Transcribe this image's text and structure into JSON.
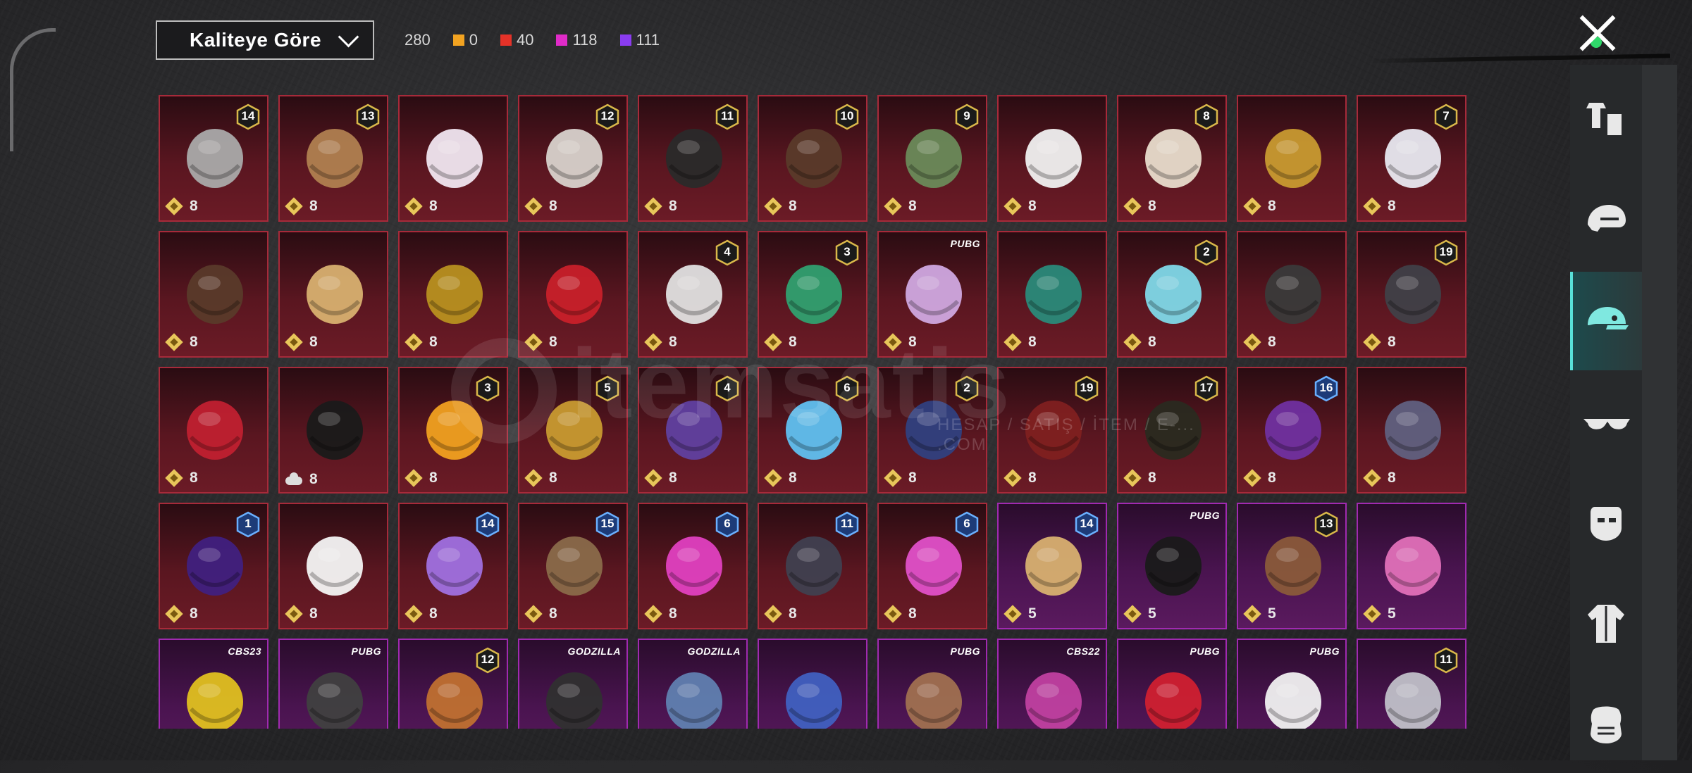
{
  "sort": {
    "label": "Kaliteye Göre"
  },
  "counts": {
    "total": "280",
    "tiers": [
      {
        "color": "#f2a321",
        "value": "0"
      },
      {
        "color": "#e53228",
        "value": "40"
      },
      {
        "color": "#e02bc8",
        "value": "118"
      },
      {
        "color": "#8a3cf0",
        "value": "111"
      }
    ]
  },
  "sidebar": {
    "items": [
      {
        "icon": "outfit-icon",
        "active": false
      },
      {
        "icon": "helmet-icon",
        "active": false
      },
      {
        "icon": "cap-icon",
        "active": true
      },
      {
        "icon": "glasses-icon",
        "active": false
      },
      {
        "icon": "mask-icon",
        "active": false
      },
      {
        "icon": "jacket-icon",
        "active": false
      },
      {
        "icon": "face-mask-icon",
        "active": false
      }
    ]
  },
  "watermark": {
    "brand": "itemsatis",
    "sub": "HESAP / SATIŞ / İTEM / E-... .COM"
  },
  "items": [
    {
      "q": "red",
      "badge": "14",
      "val": "8",
      "icon": "cat-ear-mask-hair-icon",
      "c": "#aaa"
    },
    {
      "q": "red",
      "badge": "13",
      "val": "8",
      "icon": "pink-hat-hair-icon",
      "c": "#b08050"
    },
    {
      "q": "red",
      "badge": "",
      "val": "8",
      "icon": "white-ponytail-icon",
      "c": "#f0e6f0"
    },
    {
      "q": "red",
      "badge": "12",
      "val": "8",
      "icon": "silver-bun-hair-icon",
      "c": "#d8d2cc"
    },
    {
      "q": "red",
      "badge": "11",
      "val": "8",
      "icon": "black-hair-icon",
      "c": "#2a2a2a"
    },
    {
      "q": "red",
      "badge": "10",
      "val": "8",
      "icon": "brown-long-hair-icon",
      "c": "#5a3a2a"
    },
    {
      "q": "red",
      "badge": "9",
      "val": "8",
      "icon": "zombie-head-icon",
      "c": "#6a8a5a"
    },
    {
      "q": "red",
      "badge": "",
      "val": "8",
      "icon": "white-cowboy-hat-icon",
      "c": "#f0f0f0"
    },
    {
      "q": "red",
      "badge": "8",
      "val": "8",
      "icon": "blonde-short-hair-icon",
      "c": "#e8dccc"
    },
    {
      "q": "red",
      "badge": "",
      "val": "8",
      "icon": "golden-laurel-head-icon",
      "c": "#c89a30"
    },
    {
      "q": "red",
      "badge": "7",
      "val": "8",
      "icon": "white-long-hair-icon",
      "c": "#e8e8f0"
    },
    {
      "q": "red",
      "badge": "",
      "val": "8",
      "icon": "cat-ear-curly-hair-icon",
      "c": "#5a3a2a"
    },
    {
      "q": "red",
      "badge": "",
      "val": "8",
      "icon": "blonde-ponytail-icon",
      "c": "#d8b070"
    },
    {
      "q": "red",
      "badge": "",
      "val": "8",
      "icon": "gold-robot-helmet-icon",
      "c": "#b89020"
    },
    {
      "q": "red",
      "badge": "",
      "val": "8",
      "icon": "red-helmet-icon",
      "c": "#c8202a"
    },
    {
      "q": "red",
      "badge": "4",
      "val": "8",
      "icon": "snowman-top-hat-icon",
      "c": "#e0e0e0"
    },
    {
      "q": "red",
      "badge": "3",
      "val": "8",
      "icon": "joker-head-icon",
      "c": "#30a070"
    },
    {
      "q": "red",
      "badge": "PUBG",
      "val": "8",
      "icon": "lavender-bob-hair-icon",
      "c": "#d0a8e0"
    },
    {
      "q": "red",
      "badge": "",
      "val": "8",
      "icon": "dragon-helmet-icon",
      "c": "#2a8a7a"
    },
    {
      "q": "red",
      "badge": "2",
      "val": "8",
      "icon": "blue-bucket-hat-icon",
      "c": "#80d8e8"
    },
    {
      "q": "red",
      "badge": "",
      "val": "8",
      "icon": "oni-mask-helmet-icon",
      "c": "#3a3a3a"
    },
    {
      "q": "red",
      "badge": "19",
      "val": "8",
      "icon": "dark-armor-helmet-icon",
      "c": "#404048"
    },
    {
      "q": "red",
      "badge": "",
      "val": "8",
      "icon": "red-cyber-helmet-icon",
      "c": "#c02030"
    },
    {
      "q": "red",
      "badge": "",
      "val": "8",
      "icon": "black-bat-helmet-icon",
      "c": "#1a1a1a",
      "cloud": true
    },
    {
      "q": "red",
      "badge": "3",
      "val": "8",
      "icon": "fries-hat-icon",
      "c": "#f0a020"
    },
    {
      "q": "red",
      "badge": "5",
      "val": "8",
      "icon": "gold-knight-helmet-icon",
      "c": "#c89a30"
    },
    {
      "q": "red",
      "badge": "4",
      "val": "8",
      "icon": "purple-gold-helmet-icon",
      "c": "#6040a0"
    },
    {
      "q": "red",
      "badge": "6",
      "val": "8",
      "icon": "ice-block-head-icon",
      "c": "#60c0f0"
    },
    {
      "q": "red",
      "badge": "2",
      "val": "8",
      "icon": "samurai-mech-helmet-icon",
      "c": "#304080"
    },
    {
      "q": "red",
      "badge": "19",
      "val": "8",
      "icon": "demon-helmet-icon",
      "c": "#802020"
    },
    {
      "q": "red",
      "badge": "17",
      "val": "8",
      "icon": "black-gold-helmet-icon",
      "c": "#2a2a20"
    },
    {
      "q": "red",
      "badge": "16",
      "val": "8",
      "icon": "purple-neon-helmet-icon",
      "c": "#7030a0"
    },
    {
      "q": "red",
      "badge": "",
      "val": "8",
      "icon": "steel-visor-helmet-icon",
      "c": "#606080"
    },
    {
      "q": "red",
      "badge": "1",
      "val": "8",
      "icon": "purple-cyber-helmet-icon",
      "c": "#402080"
    },
    {
      "q": "red",
      "badge": "",
      "val": "8",
      "icon": "ghost-sheet-icon",
      "c": "#f4f4f4"
    },
    {
      "q": "red",
      "badge": "14",
      "val": "8",
      "icon": "lilac-fluffy-hair-icon",
      "c": "#a070e0"
    },
    {
      "q": "red",
      "badge": "15",
      "val": "8",
      "icon": "helmet-ponytail-icon",
      "c": "#8a6a4a"
    },
    {
      "q": "red",
      "badge": "6",
      "val": "8",
      "icon": "pink-tv-head-icon",
      "c": "#e040c0"
    },
    {
      "q": "red",
      "badge": "11",
      "val": "8",
      "icon": "visor-robot-helmet-icon",
      "c": "#404050"
    },
    {
      "q": "red",
      "badge": "6",
      "val": "8",
      "icon": "pink-monitor-head-icon",
      "c": "#e050c8"
    },
    {
      "q": "purple",
      "badge": "14",
      "val": "5",
      "icon": "blonde-flower-hair-icon",
      "c": "#d8b070"
    },
    {
      "q": "purple",
      "badge": "PUBG",
      "val": "5",
      "icon": "black-wavy-hair-icon",
      "c": "#1a1a1a"
    },
    {
      "q": "purple",
      "badge": "13",
      "val": "5",
      "icon": "goggles-cap-icon",
      "c": "#8a5a3a"
    },
    {
      "q": "purple",
      "badge": "",
      "val": "5",
      "icon": "pink-twintail-hair-icon",
      "c": "#e070b8"
    },
    {
      "q": "purple",
      "badge": "CBS23",
      "val": "",
      "icon": "cat-headphones-icon",
      "c": "#e0c020"
    },
    {
      "q": "purple",
      "badge": "PUBG",
      "val": "",
      "icon": "cap-sunglasses-icon",
      "c": "#404040"
    },
    {
      "q": "purple",
      "badge": "12",
      "val": "",
      "icon": "orange-pigtail-hair-icon",
      "c": "#c07030"
    },
    {
      "q": "purple",
      "badge": "GODZILLA",
      "val": "",
      "icon": "spiked-cap-icon",
      "c": "#303030"
    },
    {
      "q": "purple",
      "badge": "GODZILLA",
      "val": "",
      "icon": "blue-messy-hair-icon",
      "c": "#6080b0"
    },
    {
      "q": "purple",
      "badge": "",
      "val": "",
      "icon": "blue-long-hair-icon",
      "c": "#4060c0"
    },
    {
      "q": "purple",
      "badge": "PUBG",
      "val": "",
      "icon": "cow-mask-icon",
      "c": "#a07050"
    },
    {
      "q": "purple",
      "badge": "CBS22",
      "val": "",
      "icon": "pink-purple-hair-icon",
      "c": "#c040a0"
    },
    {
      "q": "purple",
      "badge": "PUBG",
      "val": "",
      "icon": "red-hair-icon",
      "c": "#d02030"
    },
    {
      "q": "purple",
      "badge": "PUBG",
      "val": "",
      "icon": "panda-mask-icon",
      "c": "#f0f0f0"
    },
    {
      "q": "purple",
      "badge": "11",
      "val": "",
      "icon": "flower-crown-hair-icon",
      "c": "#c0c0c8"
    }
  ]
}
